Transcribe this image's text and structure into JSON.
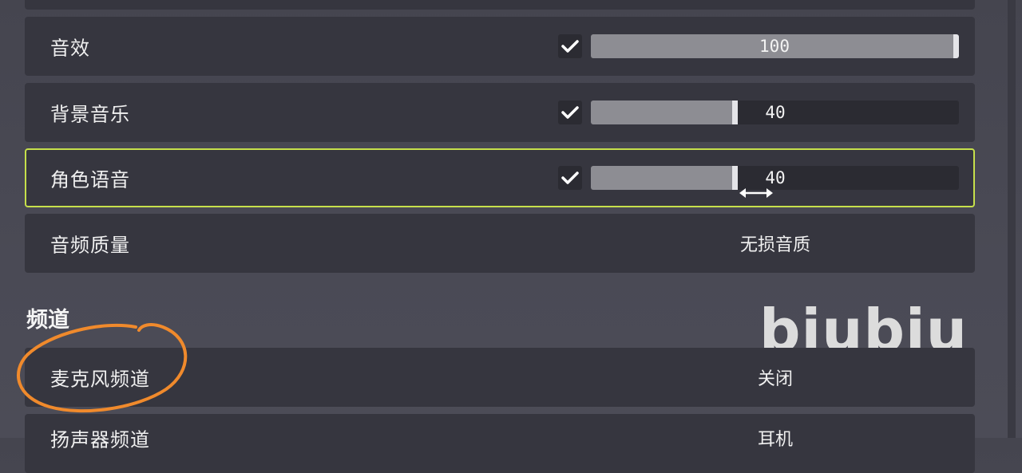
{
  "settings": {
    "sound_effects": {
      "label": "音效",
      "enabled": true,
      "value": "100",
      "level": 1.0
    },
    "bg_music": {
      "label": "背景音乐",
      "enabled": true,
      "value": "40",
      "level": 0.4
    },
    "voice": {
      "label": "角色语音",
      "enabled": true,
      "value": "40",
      "level": 0.4
    },
    "audio_quality": {
      "label": "音频质量",
      "value": "无损音质"
    }
  },
  "channel_section": {
    "title": "频道",
    "mic_channel": {
      "label": "麦克风频道",
      "value": "关闭"
    },
    "speaker_channel": {
      "label": "扬声器频道",
      "value": "耳机"
    }
  },
  "watermark": "biubiu",
  "colors": {
    "focus_border": "#c6e04b",
    "annotation_circle": "#f08a2c"
  },
  "icons": {
    "check": "checkmark-icon",
    "resize": "resize-horizontal-icon"
  }
}
